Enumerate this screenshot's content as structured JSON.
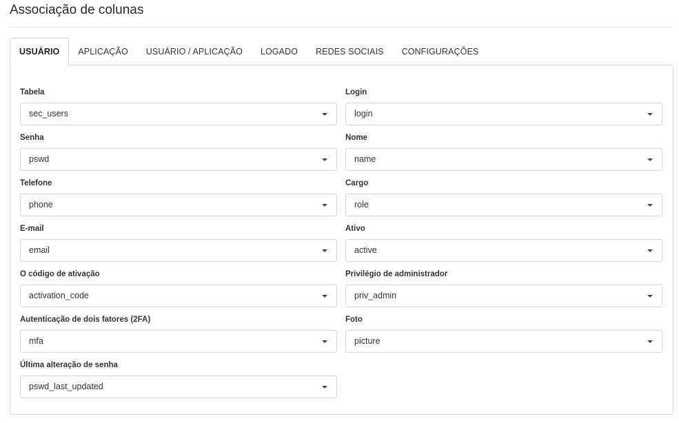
{
  "page": {
    "title": "Associação de colunas"
  },
  "tabs": [
    {
      "label": "USUÁRIO",
      "active": true
    },
    {
      "label": "APLICAÇÃO",
      "active": false
    },
    {
      "label": "USUÁRIO / APLICAÇÃO",
      "active": false
    },
    {
      "label": "LOGADO",
      "active": false
    },
    {
      "label": "REDES SOCIAIS",
      "active": false
    },
    {
      "label": "CONFIGURAÇÕES",
      "active": false
    }
  ],
  "fields": {
    "tabela": {
      "label": "Tabela",
      "value": "sec_users"
    },
    "login": {
      "label": "Login",
      "value": "login"
    },
    "senha": {
      "label": "Senha",
      "value": "pswd"
    },
    "nome": {
      "label": "Nome",
      "value": "name"
    },
    "telefone": {
      "label": "Telefone",
      "value": "phone"
    },
    "cargo": {
      "label": "Cargo",
      "value": "role"
    },
    "email": {
      "label": "E-mail",
      "value": "email"
    },
    "ativo": {
      "label": "Ativo",
      "value": "active"
    },
    "codigo_ativacao": {
      "label": "O código de ativação",
      "value": "activation_code"
    },
    "privilegio_admin": {
      "label": "Privilégio de administrador",
      "value": "priv_admin"
    },
    "autenticacao_2fa": {
      "label": "Autenticação de dois fatores (2FA)",
      "value": "mfa"
    },
    "foto": {
      "label": "Foto",
      "value": "picture"
    },
    "ultima_alteracao_senha": {
      "label": "Última alteração de senha",
      "value": "pswd_last_updated"
    }
  }
}
